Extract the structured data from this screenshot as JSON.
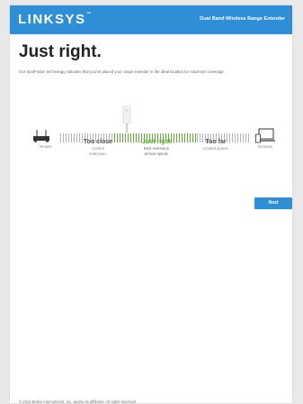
{
  "header": {
    "logo": "LINKSYS",
    "logo_mark": "™",
    "product": "Dual Band Wireless Range Extender"
  },
  "title": "Just right.",
  "description": "Our SpotFinder technology indicates that you've placed your range extender in the ideal location for maximum coverage.",
  "meter": {
    "router_label": "Router",
    "devices_label": "Devices",
    "zones": [
      {
        "title": "Too close",
        "desc1": "Limited",
        "desc2": "extension."
      },
      {
        "title": "Just right",
        "desc1": "Best extension",
        "desc2": "at best speed."
      },
      {
        "title": "Too far",
        "desc1": "Limited speed.",
        "desc2": ""
      }
    ]
  },
  "next_label": "Next",
  "footer": "© 2016 Belkin International, Inc. and/or its affiliates. All rights reserved.",
  "colors": {
    "accent": "#2f8fd6",
    "good": "#5fb030",
    "neutral": "#b5b5b5"
  }
}
